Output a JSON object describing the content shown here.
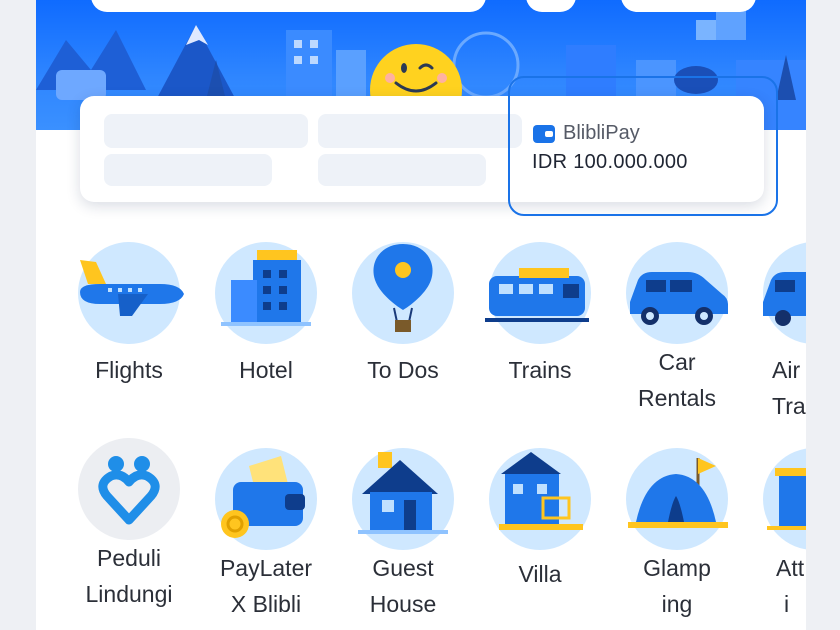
{
  "wallet": {
    "name": "BlibliPay",
    "amount": "IDR 100.000.000"
  },
  "services_row1": [
    {
      "label_lines": [
        "Flights"
      ],
      "icon": "airplane-icon"
    },
    {
      "label_lines": [
        "Hotel"
      ],
      "icon": "hotel-building-icon"
    },
    {
      "label_lines": [
        "To Dos"
      ],
      "icon": "hot-air-balloon-icon"
    },
    {
      "label_lines": [
        "Trains"
      ],
      "icon": "train-icon"
    },
    {
      "label_lines": [
        "Car",
        "Rentals"
      ],
      "icon": "car-icon"
    },
    {
      "label_lines": [
        "Air",
        "Tran"
      ],
      "icon": "airport-transfer-icon"
    }
  ],
  "services_row2": [
    {
      "label_lines": [
        "Peduli",
        "Lindungi"
      ],
      "icon": "peduli-lindungi-icon"
    },
    {
      "label_lines": [
        "PayLater",
        "X Blibli"
      ],
      "icon": "paylater-wallet-icon"
    },
    {
      "label_lines": [
        "Guest",
        "House"
      ],
      "icon": "guest-house-icon"
    },
    {
      "label_lines": [
        "Villa"
      ],
      "icon": "villa-icon"
    },
    {
      "label_lines": [
        "Glamp",
        "ing"
      ],
      "icon": "glamping-tent-icon"
    },
    {
      "label_lines": [
        "Att",
        "i"
      ],
      "icon": "attraction-icon"
    }
  ],
  "colors": {
    "brand_blue": "#1a73e8",
    "hero_blue": "#0f6bff",
    "icon_bg": "#cfe8ff",
    "mascot_yellow": "#ffd21f"
  }
}
